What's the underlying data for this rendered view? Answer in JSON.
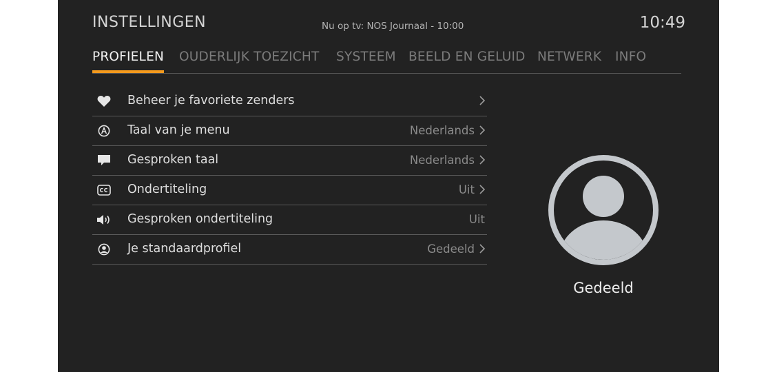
{
  "header": {
    "title": "INSTELLINGEN",
    "now_playing": "Nu op tv: NOS Journaal - 10:00",
    "clock": "10:49"
  },
  "tabs": [
    {
      "label": "PROFIELEN",
      "active": true
    },
    {
      "label": "OUDERLIJK TOEZICHT",
      "active": false
    },
    {
      "label": "SYSTEEM",
      "active": false
    },
    {
      "label": "BEELD EN GELUID",
      "active": false
    },
    {
      "label": "NETWERK",
      "active": false
    },
    {
      "label": "INFO",
      "active": false
    }
  ],
  "menu": [
    {
      "icon": "heart-icon",
      "label": "Beheer je favoriete zenders",
      "value": "",
      "chevron": true
    },
    {
      "icon": "circled-a-icon",
      "label": "Taal van je menu",
      "value": "Nederlands",
      "chevron": true
    },
    {
      "icon": "speech-bubble-icon",
      "label": "Gesproken taal",
      "value": "Nederlands",
      "chevron": true
    },
    {
      "icon": "closed-captions-icon",
      "label": "Ondertiteling",
      "value": "Uit",
      "chevron": true
    },
    {
      "icon": "speaker-icon",
      "label": "Gesproken ondertiteling",
      "value": "Uit",
      "chevron": false
    },
    {
      "icon": "user-circle-icon",
      "label": "Je standaardprofiel",
      "value": "Gedeeld",
      "chevron": true
    }
  ],
  "profile": {
    "icon": "avatar-icon",
    "name": "Gedeeld"
  },
  "colors": {
    "background": "#222222",
    "accent": "#f39a1e",
    "text": "#dedede",
    "muted": "#8a8a8a"
  }
}
